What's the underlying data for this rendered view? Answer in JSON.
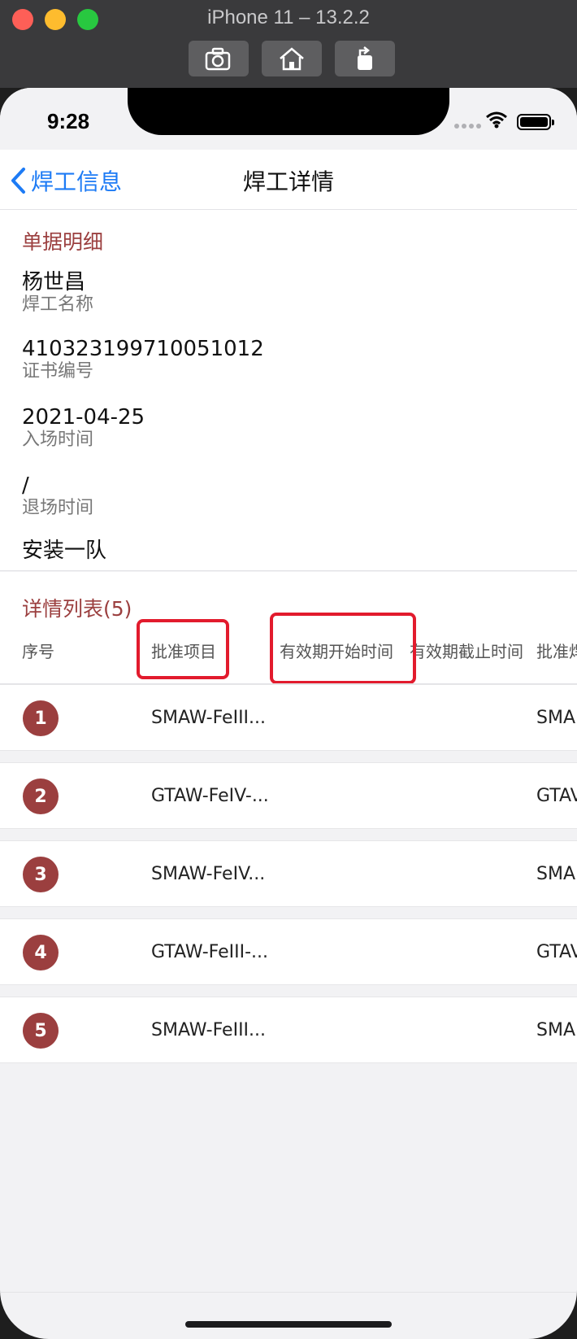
{
  "simulator": {
    "title": "iPhone 11 – 13.2.2",
    "buttons": [
      "screenshot-icon",
      "home-icon",
      "rotate-icon"
    ]
  },
  "status_bar": {
    "time": "9:28"
  },
  "nav": {
    "back_label": "焊工信息",
    "title": "焊工详情"
  },
  "details": {
    "section_title": "单据明细",
    "fields": [
      {
        "value": "杨世昌",
        "label": "焊工名称"
      },
      {
        "value": "410323199710051012",
        "label": "证书编号"
      },
      {
        "value": "2021-04-25",
        "label": "入场时间"
      },
      {
        "value": "/",
        "label": "退场时间"
      },
      {
        "value": "安装一队",
        "label": ""
      }
    ]
  },
  "list": {
    "title": "详情列表(5)",
    "columns": [
      "序号",
      "批准项目",
      "有效期开始时间",
      "有效期截止时间",
      "批准焊"
    ],
    "rows": [
      {
        "index": "1",
        "project": "SMAW-FeIII...",
        "tail": "SMA"
      },
      {
        "index": "2",
        "project": "GTAW-FeIV-...",
        "tail": "GTAV"
      },
      {
        "index": "3",
        "project": "SMAW-FeIV...",
        "tail": "SMA"
      },
      {
        "index": "4",
        "project": "GTAW-FeIII-...",
        "tail": "GTAV"
      },
      {
        "index": "5",
        "project": "SMAW-FeIII...",
        "tail": "SMA"
      }
    ]
  },
  "colors": {
    "accent": "#9b3f3f",
    "link": "#1d7bf5",
    "highlight": "#e21b2d"
  }
}
